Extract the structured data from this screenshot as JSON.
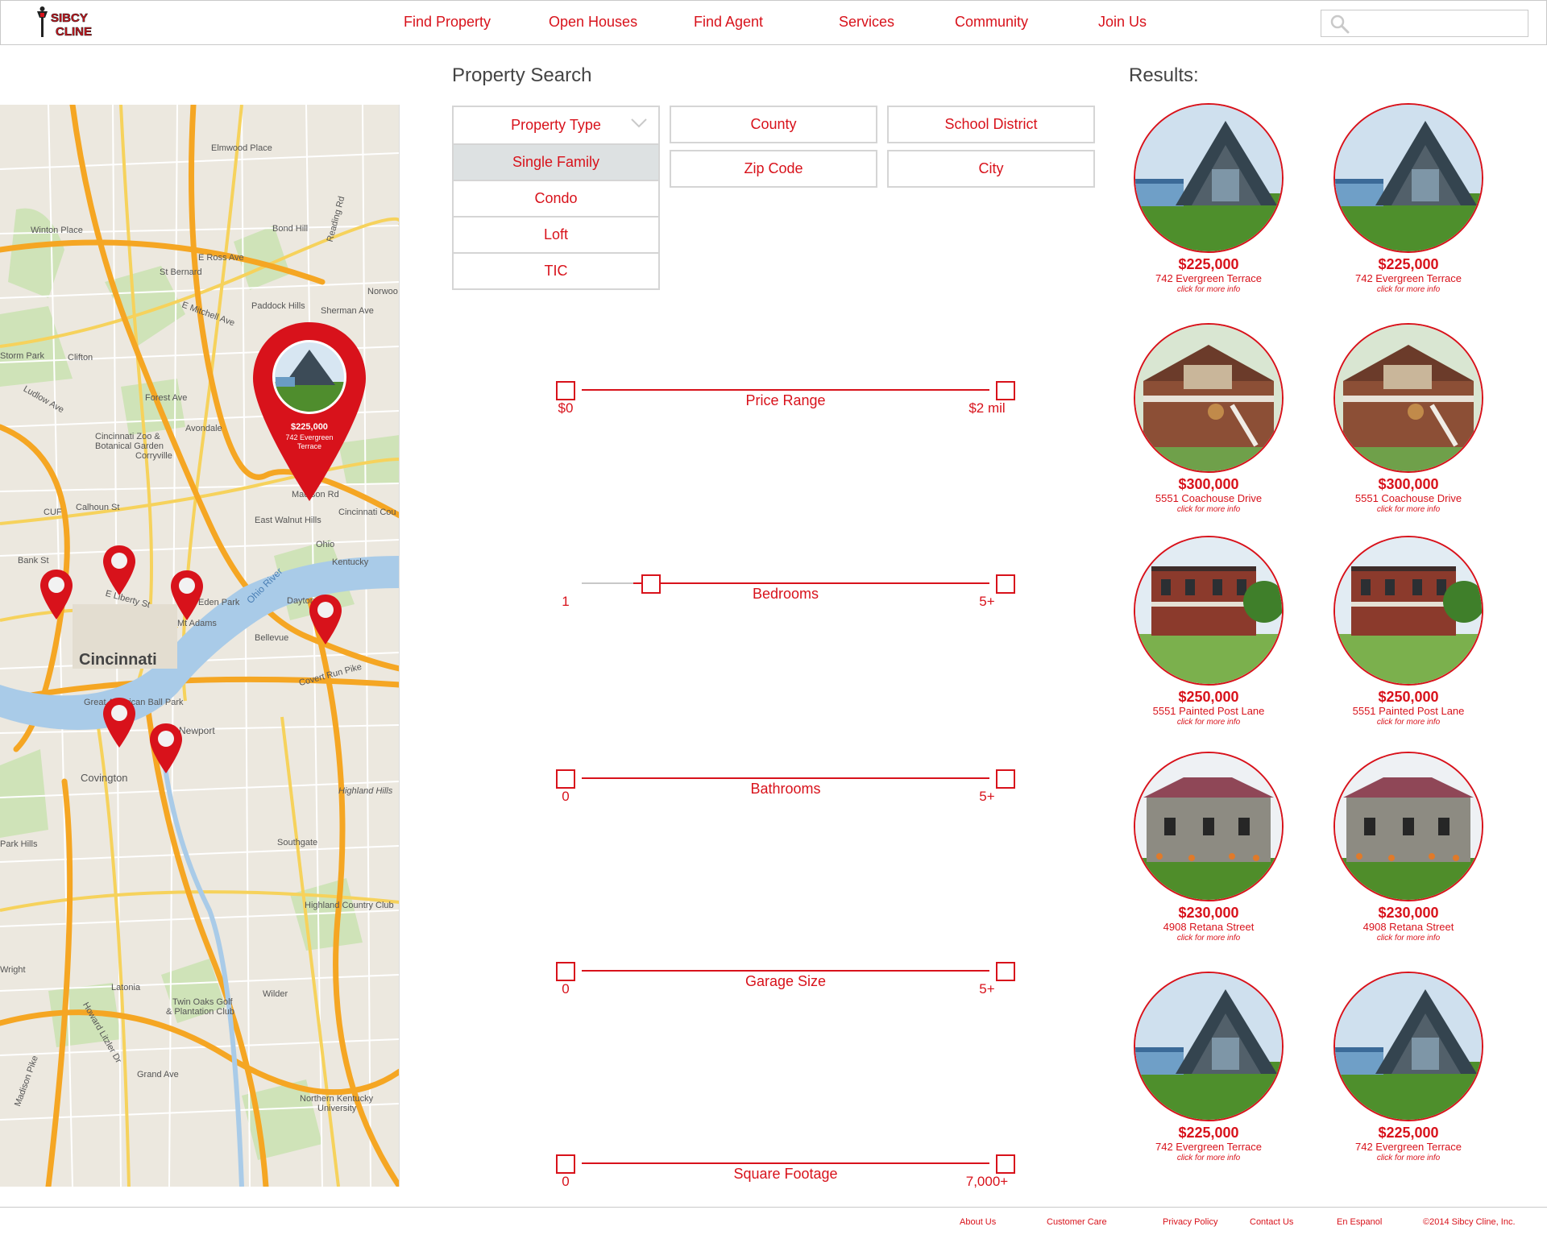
{
  "brand": {
    "logo_line1": "SIBCY",
    "logo_line2": "CLINE",
    "accent": "#d8121b"
  },
  "nav": {
    "find_property": "Find Property",
    "open_houses": "Open Houses",
    "find_agent": "Find Agent",
    "services": "Services",
    "community": "Community",
    "join_us": "Join Us"
  },
  "search": {
    "placeholder": "",
    "icon": "search-icon"
  },
  "property_search": {
    "title": "Property Search",
    "type_header": "Property Type",
    "types": [
      "Single Family",
      "Condo",
      "Loft",
      "TIC"
    ],
    "selected_type": "Single Family",
    "county": "County",
    "school_district": "School District",
    "zip_code": "Zip Code",
    "city": "City"
  },
  "sliders": {
    "price": {
      "label": "Price Range",
      "min": "$0",
      "max": "$2 mil"
    },
    "bedrooms": {
      "label": "Bedrooms",
      "min": "1",
      "max": "5+"
    },
    "bathrooms": {
      "label": "Bathrooms",
      "min": "0",
      "max": "5+"
    },
    "garage": {
      "label": "Garage Size",
      "min": "0",
      "max": "5+"
    },
    "sqft": {
      "label": "Square Footage",
      "min": "0",
      "max": "7,000+"
    }
  },
  "map": {
    "popup": {
      "price": "$225,000",
      "address_line1": "742 Evergreen",
      "address_line2": "Terrace"
    },
    "labels": {
      "cincinnati": "Cincinnati",
      "covington": "Covington",
      "newport": "Newport",
      "zoo": "Cincinnati Zoo &",
      "zoo2": "Botanical Garden",
      "ohio_river": "Ohio River",
      "clifton": "Clifton",
      "avondale": "Avondale",
      "forest_ave": "Forest Ave",
      "corryville": "Corryville",
      "bond_hill": "Bond Hill",
      "winton_place": "Winton Place",
      "elmwood": "Elmwood Place",
      "st_bernard": "St Bernard",
      "paddock": "Paddock Hills",
      "e_mitchell": "E Mitchell Ave",
      "e_ross": "E Ross Ave",
      "madison_rd": "Madison Rd",
      "e_walnut": "East Walnut Hills",
      "bellevue": "Bellevue",
      "dayton": "Dayton",
      "kentucky": "Kentucky",
      "ohio": "Ohio",
      "highland_hills": "Highland Hills",
      "southgate": "Southgate",
      "highland_cc": "Highland Country Club",
      "twin_oaks": "Twin Oaks Golf",
      "twin_oaks2": "& Plantation Club",
      "latonia": "Latonia",
      "wilder": "Wilder",
      "nku": "Northern Kentucky",
      "nku2": "University",
      "great_american": "Great American Ball Park",
      "calhoun": "Calhoun St",
      "e_liberty": "E Liberty St",
      "mt_adams": "Mt Adams",
      "eden_park": "Eden Park",
      "park_hills": "Park Hills",
      "wright": "Wright",
      "norwood": "Norwoo",
      "storm_park": "Storm Park",
      "ludlow": "Ludlow Ave",
      "cuf": "CUF",
      "bank_st": "Bank St",
      "covert_run": "Covert Run Pike",
      "grand_ave": "Grand Ave",
      "howard_litzler": "Howard Litzler Dr",
      "madison_pike": "Madison Pike",
      "sherman": "Sherman Ave",
      "reading_rd": "Reading Rd",
      "cincinnati_cou": "Cincinnati Cou"
    }
  },
  "results": {
    "title": "Results:",
    "more_text": "click for more info",
    "items": [
      {
        "price": "$225,000",
        "address": "742 Evergreen Terrace",
        "photo": "a-frame"
      },
      {
        "price": "$225,000",
        "address": "742 Evergreen Terrace",
        "photo": "a-frame"
      },
      {
        "price": "$300,000",
        "address": "5551 Coachouse Drive",
        "photo": "lodge"
      },
      {
        "price": "$300,000",
        "address": "5551 Coachouse Drive",
        "photo": "lodge"
      },
      {
        "price": "$250,000",
        "address": "5551 Painted Post Lane",
        "photo": "brick"
      },
      {
        "price": "$250,000",
        "address": "5551 Painted Post Lane",
        "photo": "brick"
      },
      {
        "price": "$230,000",
        "address": "4908 Retana Street",
        "photo": "stone"
      },
      {
        "price": "$230,000",
        "address": "4908 Retana Street",
        "photo": "stone"
      },
      {
        "price": "$225,000",
        "address": "742 Evergreen Terrace",
        "photo": "a-frame"
      },
      {
        "price": "$225,000",
        "address": "742 Evergreen Terrace",
        "photo": "a-frame"
      }
    ]
  },
  "footer": {
    "about": "About Us",
    "care": "Customer Care",
    "privacy": "Privacy Policy",
    "contact": "Contact Us",
    "espanol": "En Espanol",
    "copyright": "©2014 Sibcy Cline, Inc."
  }
}
